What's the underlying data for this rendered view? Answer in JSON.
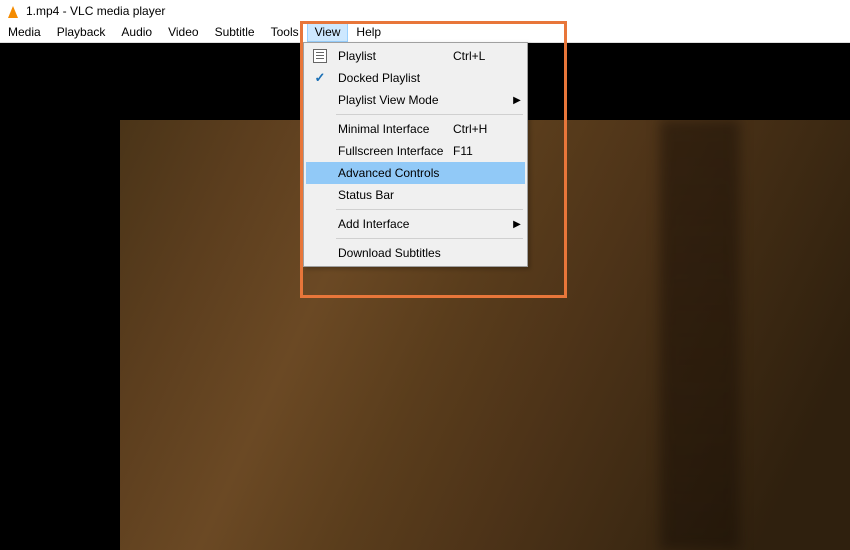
{
  "titlebar": {
    "text": "1.mp4 - VLC media player"
  },
  "menubar": {
    "items": [
      {
        "label": "Media"
      },
      {
        "label": "Playback"
      },
      {
        "label": "Audio"
      },
      {
        "label": "Video"
      },
      {
        "label": "Subtitle"
      },
      {
        "label": "Tools"
      },
      {
        "label": "View"
      },
      {
        "label": "Help"
      }
    ]
  },
  "dropdown": {
    "rows": [
      {
        "label": "Playlist",
        "shortcut": "Ctrl+L",
        "icon": "playlist"
      },
      {
        "label": "Docked Playlist",
        "icon": "check"
      },
      {
        "label": "Playlist View Mode",
        "submenu": true
      },
      {
        "sep": true
      },
      {
        "label": "Minimal Interface",
        "shortcut": "Ctrl+H"
      },
      {
        "label": "Fullscreen Interface",
        "shortcut": "F11"
      },
      {
        "label": "Advanced Controls",
        "highlight": true
      },
      {
        "label": "Status Bar"
      },
      {
        "sep": true
      },
      {
        "label": "Add Interface",
        "submenu": true
      },
      {
        "sep": true
      },
      {
        "label": "Download Subtitles"
      }
    ]
  }
}
